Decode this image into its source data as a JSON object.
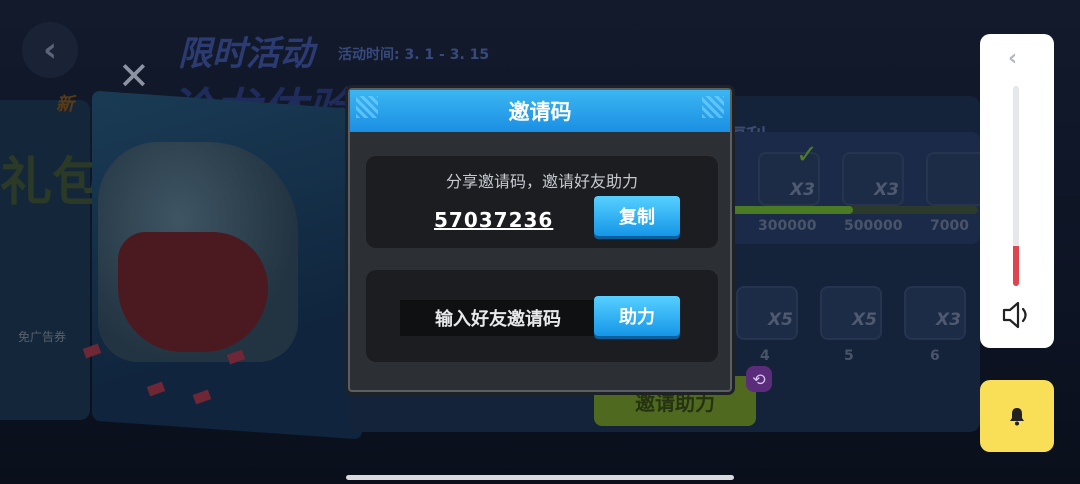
{
  "background": {
    "event_title_line1": "限时活动",
    "event_title_line2": "沧龙体验卡",
    "event_date": "活动时间: 3. 1 - 3. 15",
    "new_badge": "新",
    "left_big_text": "礼包",
    "left_small_text": "免广告券",
    "welfare_tab": "福利",
    "milestones": [
      "300000",
      "500000",
      "7000"
    ],
    "top_rewards": [
      {
        "mult": "X3"
      },
      {
        "mult": "X3"
      },
      {
        "mult": ""
      }
    ],
    "bottom_rewards": [
      {
        "mult": "X5",
        "day": "4"
      },
      {
        "mult": "X5",
        "day": "5"
      },
      {
        "mult": "X3",
        "day": "6"
      }
    ],
    "invite_help_button": "邀请助力"
  },
  "dialog": {
    "title": "邀请码",
    "share_text": "分享邀请码，邀请好友助力",
    "invite_code": "57037236",
    "copy_button": "复制",
    "input_placeholder": "输入好友邀请码",
    "help_button": "助力"
  },
  "volume": {
    "level": 0.2
  },
  "colors": {
    "dialog_header": "#1b8fe3",
    "button_blue": "#1596e8",
    "volume_fill": "#e0444e",
    "bell_bg": "#f9df57"
  }
}
